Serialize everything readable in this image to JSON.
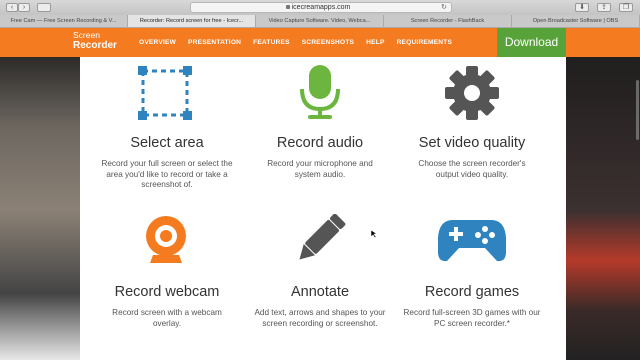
{
  "browser": {
    "url": "icecreamapps.com",
    "tabs": [
      {
        "label": "Free Cam — Free Screen Recording & V..."
      },
      {
        "label": "Recorder: Record screen for free - Icecr..."
      },
      {
        "label": "Video Capture Software. Video, Webca..."
      },
      {
        "label": "Screen Recorder - FlashBack"
      },
      {
        "label": "Open Broadcaster Software | OBS"
      }
    ]
  },
  "site": {
    "logo_line1": "Screen",
    "logo_line2": "Recorder",
    "nav": [
      "OVERVIEW",
      "PRESENTATION",
      "FEATURES",
      "SCREENSHOTS",
      "HELP",
      "REQUIREMENTS"
    ],
    "download_label": "Download"
  },
  "features": [
    {
      "title": "Select area",
      "desc": "Record your full screen or select the area you'd like to record or take a screenshot of.",
      "icon": "select-area-icon"
    },
    {
      "title": "Record audio",
      "desc": "Record your microphone and system audio.",
      "icon": "microphone-icon"
    },
    {
      "title": "Set video quality",
      "desc": "Choose the screen recorder's output video quality.",
      "icon": "gear-icon"
    },
    {
      "title": "Record webcam",
      "desc": "Record screen with a webcam overlay.",
      "icon": "webcam-icon"
    },
    {
      "title": "Annotate",
      "desc": "Add text, arrows and shapes to your screen recording or screenshot.",
      "icon": "pencil-icon"
    },
    {
      "title": "Record games",
      "desc": "Record full-screen 3D games with our PC screen recorder.*",
      "icon": "gamepad-icon"
    }
  ],
  "colors": {
    "nav": "#f47b20",
    "download": "#57a33a",
    "select_icon": "#2f83bf",
    "mic_icon": "#6cb53f",
    "gear_icon": "#555555",
    "webcam_icon": "#f47b20",
    "pencil_icon": "#555555",
    "gamepad_icon": "#2f83bf"
  }
}
